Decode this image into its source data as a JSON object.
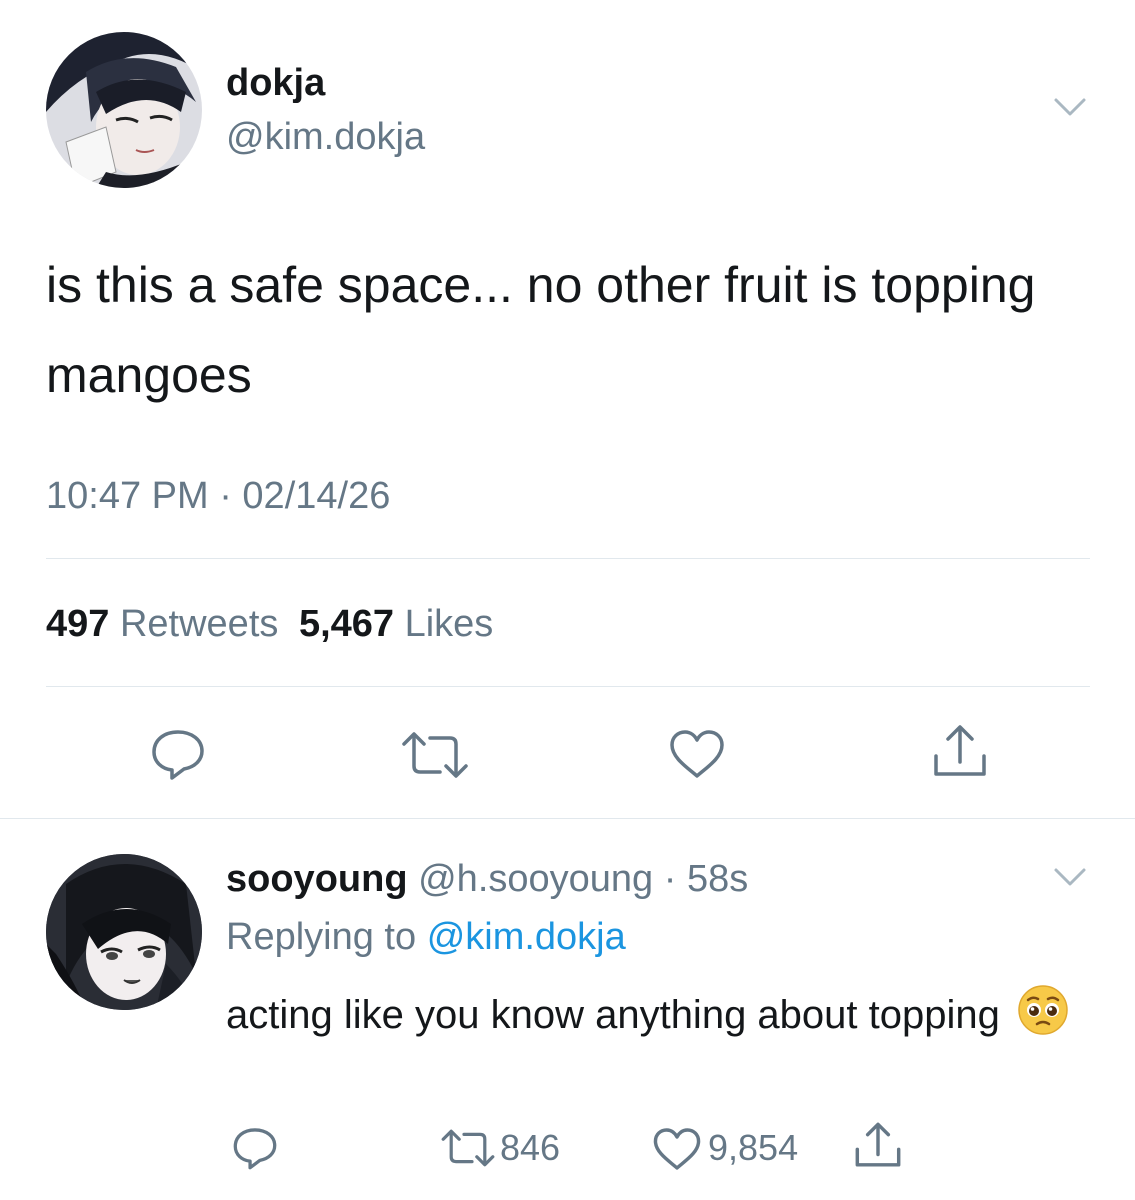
{
  "main_tweet": {
    "display_name": "dokja",
    "handle": "@kim.dokja",
    "text": "is this a safe space... no other fruit is topping mangoes",
    "timestamp": "10:47 PM · 02/14/26",
    "retweets_count": "497",
    "retweets_label": "Retweets",
    "likes_count": "5,467",
    "likes_label": "Likes"
  },
  "reply_tweet": {
    "display_name": "sooyoung",
    "handle_time": "@h.sooyoung · 58s",
    "replying_prefix": "Replying to",
    "replying_handle": "@kim.dokja",
    "text": "acting like you know anything about topping",
    "emoji": "pleading-face-emoji",
    "retweets_count": "846",
    "likes_count": "9,854"
  },
  "colors": {
    "text": "#14171a",
    "secondary": "#657786",
    "link": "#1b95e0",
    "divider": "#e1e8ed"
  },
  "icons": [
    "chevron-down-icon",
    "reply-icon",
    "retweet-icon",
    "heart-icon",
    "share-icon"
  ]
}
